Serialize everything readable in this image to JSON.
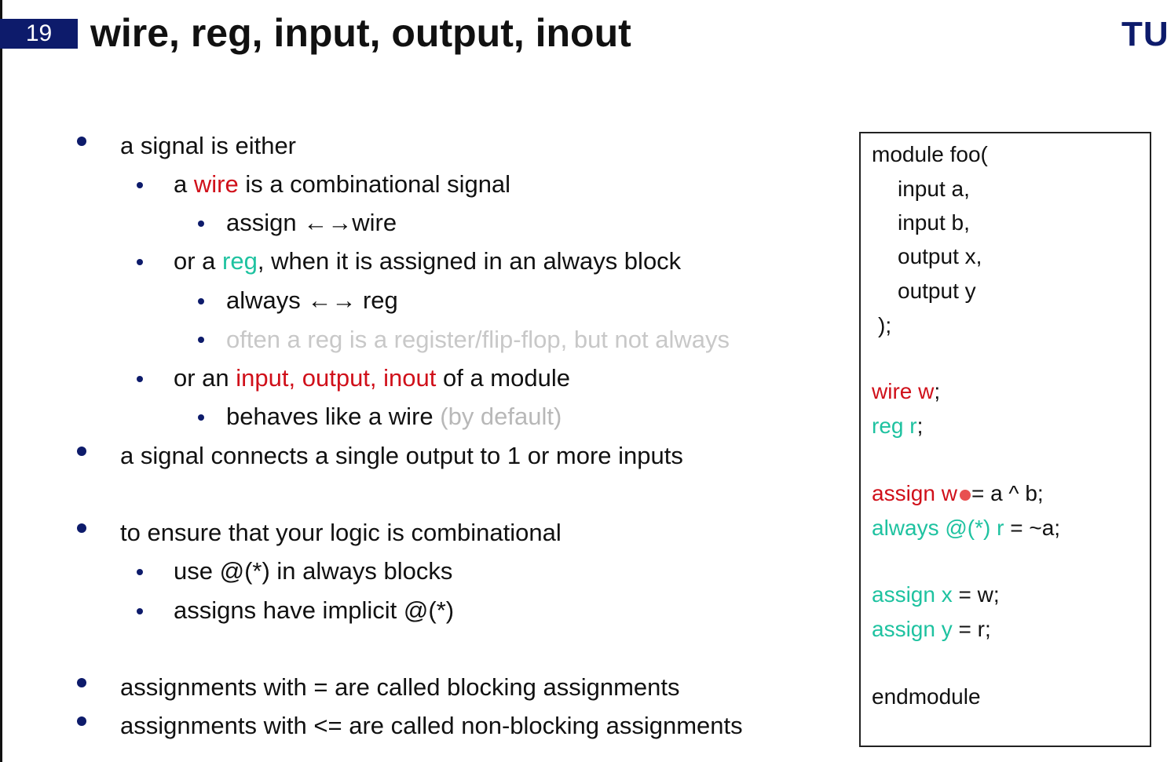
{
  "header": {
    "slide_number": "19",
    "title": "wire, reg, input, output, inout",
    "logo": "TU"
  },
  "bullets": {
    "b1": "a signal is either",
    "b1_1": {
      "pre": "a ",
      "kw": "wire",
      "post": " is a combinational signal"
    },
    "b1_1_1": {
      "pre": "assign ",
      "arrows": "←→",
      "post": "wire"
    },
    "b1_2": {
      "pre": "or a ",
      "kw": "reg",
      "post": ", when it is assigned in an always block"
    },
    "b1_2_1": {
      "pre": "always ",
      "arrows": "←→",
      "post": " reg"
    },
    "b1_2_2": "often a reg is a register/flip-flop, but not always",
    "b1_3": {
      "pre": "or an ",
      "kw": "input, output, inout",
      "post": " of a module"
    },
    "b1_3_1": {
      "pre": "behaves like a wire ",
      "note": "(by default)"
    },
    "b2": "a signal connects a single output to 1 or more inputs",
    "b3": "to ensure that your logic is combinational",
    "b3_1": "use @(*) in always blocks",
    "b3_2": "assigns have implicit @(*)",
    "b4": "assignments with = are called blocking assignments",
    "b5": "assignments with <= are called non-blocking assignments"
  },
  "code": {
    "module_open": "module foo(",
    "port_a": "input a,",
    "port_b": "input b,",
    "port_x": "output x,",
    "port_y": "output y",
    "close_paren": ");",
    "wire_kw": "wire w",
    "wire_end": ";",
    "reg_kw": "reg r",
    "reg_end": ";",
    "assign_w_kw": "assign w",
    "assign_w_rest": "= a ^ b;",
    "always_kw": "always @(*) r",
    "always_rest": " = ~a;",
    "assign_x_kw": "assign x",
    "assign_x_rest": " = w;",
    "assign_y_kw": "assign y",
    "assign_y_rest": " = r;",
    "endmodule": "endmodule"
  },
  "colors": {
    "keyword_red": "#d0101a",
    "keyword_green": "#1ec2a0",
    "accent_navy": "#0d1b6b",
    "muted_gray": "#c8c8c8"
  }
}
